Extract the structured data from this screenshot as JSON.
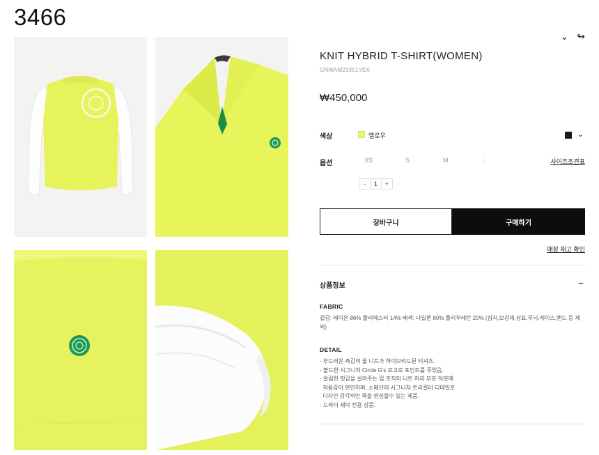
{
  "page_id": "3466",
  "header_icons": [
    "chevron-down-icon",
    "share-icon"
  ],
  "product": {
    "title": "KNIT HYBRID T-SHIRT(WOMEN)",
    "code": "GNWAM23351YEX",
    "price": "₩450,000"
  },
  "color": {
    "label": "색상",
    "selected_name": "옐로우",
    "selected_hex": "#ecf37a",
    "alt_hex": "#1b1b1b"
  },
  "option": {
    "label": "옵션",
    "sizes": [
      "XS",
      "S",
      "M",
      "L"
    ],
    "size_guide": "사이즈조견표",
    "quantity": "1",
    "minus": "-",
    "plus": "+"
  },
  "buttons": {
    "cart": "장바구니",
    "buy": "구매하기",
    "stock": "매장 재고 확인"
  },
  "info_section": {
    "title": "상품정보",
    "toggle": "−",
    "fabric_heading": "FABRIC",
    "fabric_text": "겉감: 레이온 86% 폴리에스터 14% 배색: 나일론 80% 폴리우레탄 20% (심지,보강재,상표,무늬,레이스,밴드 등 제외)",
    "detail_heading": "DETAIL",
    "detail_lines": [
      "- 부드러운 촉감의 울 니트가 하이브리드된 티셔츠.",
      "- 볼드한 시그니처 Circle G's 로고로 포인트를 주었음.",
      "- 슬림한 핏감을 살려주는 립 조직의 니트 허리 부분 덕분에",
      "  착용감이 편안하며, 소매단의 시그니처 트리컬러 디테일로",
      "  디자인 감각적인 룩을 완성할수 있는 제품.",
      "- 드라이 세탁 전용 상품."
    ]
  }
}
